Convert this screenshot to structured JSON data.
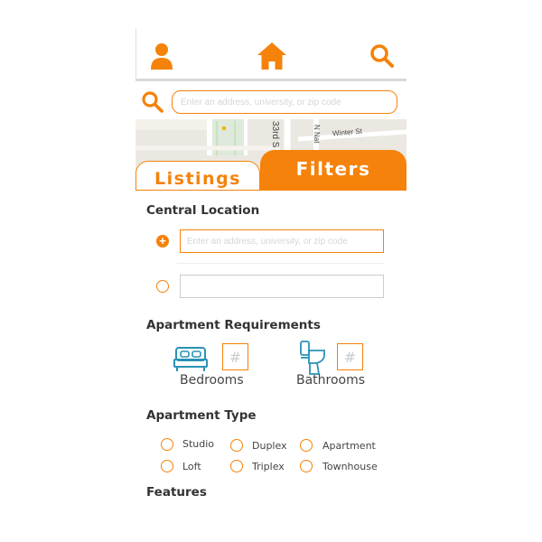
{
  "nav": {
    "icons": [
      "user-icon",
      "home-icon",
      "search-icon"
    ],
    "accent": "#f5820a"
  },
  "search": {
    "placeholder": "Enter an address, university, or zip code"
  },
  "map": {
    "labels": [
      "N Nat",
      "Winter St",
      "33rd S"
    ]
  },
  "tabs": [
    {
      "label": "Listings",
      "active": false
    },
    {
      "label": "Filters",
      "active": true
    }
  ],
  "central_location": {
    "title": "Central Location",
    "input1_placeholder": "Enter an address, university, or zip code",
    "input2_value": ""
  },
  "requirements": {
    "title": "Apartment Requirements",
    "bedrooms_label": "Bedrooms",
    "bathrooms_label": "Bathrooms",
    "number_placeholder": "#"
  },
  "apartment_type": {
    "title": "Apartment Type",
    "options": [
      "Studio",
      "Duplex",
      "Apartment",
      "Loft",
      "Triplex",
      "Townhouse"
    ]
  },
  "features": {
    "title": "Features"
  }
}
